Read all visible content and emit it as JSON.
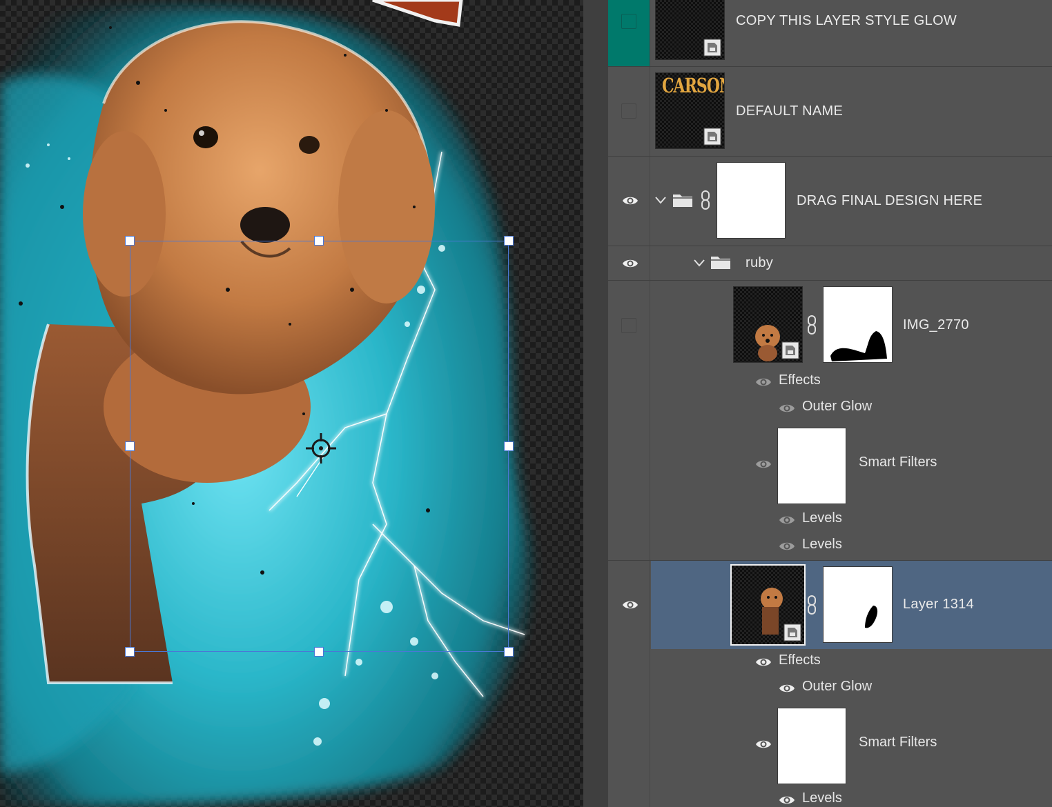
{
  "app": {
    "accent_selected_row": "#4f6682",
    "accent_top_row": "#00796b"
  },
  "canvas": {
    "artwork": "poodle-puppy-with-lightning-glow",
    "transform_box": "selected",
    "center_icon": "crosshair-icon"
  },
  "layers": [
    {
      "id": "copy-style",
      "name": "COPY THIS LAYER STYLE GLOW",
      "visible": false,
      "type": "smart-object"
    },
    {
      "id": "default-name",
      "name": "DEFAULT NAME",
      "visible": false,
      "type": "smart-object",
      "thumb_text": "CARSON"
    },
    {
      "id": "drag-final",
      "name": "DRAG FINAL DESIGN HERE",
      "visible": true,
      "type": "group"
    },
    {
      "id": "ruby",
      "name": "ruby",
      "visible": true,
      "type": "group"
    },
    {
      "id": "img2770",
      "name": "IMG_2770",
      "visible": false,
      "type": "smart-object",
      "effects_label": "Effects",
      "outer_glow_label": "Outer Glow",
      "smart_filters_label": "Smart Filters",
      "filters": [
        "Levels",
        "Levels"
      ]
    },
    {
      "id": "layer1314",
      "name": "Layer 1314",
      "visible": true,
      "type": "smart-object",
      "selected": true,
      "effects_label": "Effects",
      "outer_glow_label": "Outer Glow",
      "smart_filters_label": "Smart Filters",
      "filters": [
        "Levels"
      ]
    }
  ]
}
